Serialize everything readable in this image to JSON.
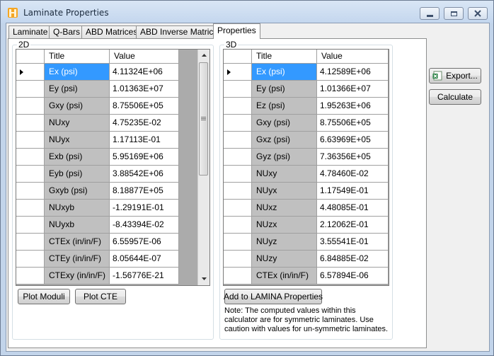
{
  "window": {
    "title": "Laminate Properties",
    "controls": [
      "minimize",
      "maximize",
      "close"
    ]
  },
  "tabs": [
    {
      "label": "Laminate",
      "active": false
    },
    {
      "label": "Q-Bars",
      "active": false
    },
    {
      "label": "ABD Matrices",
      "active": false
    },
    {
      "label": "ABD Inverse Matrices",
      "active": false
    },
    {
      "label": "Properties",
      "active": true
    }
  ],
  "group2d": {
    "title": "2D",
    "columns": {
      "title": "Title",
      "value": "Value"
    },
    "rows": [
      {
        "title": "Ex (psi)",
        "value": "4.11324E+06"
      },
      {
        "title": "Ey (psi)",
        "value": "1.01363E+07"
      },
      {
        "title": "Gxy (psi)",
        "value": "8.75506E+05"
      },
      {
        "title": "NUxy",
        "value": "4.75235E-02"
      },
      {
        "title": "NUyx",
        "value": "1.17113E-01"
      },
      {
        "title": "Exb (psi)",
        "value": "5.95169E+06"
      },
      {
        "title": "Eyb (psi)",
        "value": "3.88542E+06"
      },
      {
        "title": "Gxyb (psi)",
        "value": "8.18877E+05"
      },
      {
        "title": "NUxyb",
        "value": "-1.29191E-01"
      },
      {
        "title": "NUyxb",
        "value": "-8.43394E-02"
      },
      {
        "title": "CTEx (in/in/F)",
        "value": "6.55957E-06"
      },
      {
        "title": "CTEy (in/in/F)",
        "value": "8.05644E-07"
      },
      {
        "title": "CTExy (in/in/F)",
        "value": "-1.56776E-21"
      }
    ],
    "buttons": {
      "plot_moduli": "Plot Moduli",
      "plot_cte": "Plot CTE"
    }
  },
  "group3d": {
    "title": "3D",
    "columns": {
      "title": "Title",
      "value": "Value"
    },
    "rows": [
      {
        "title": "Ex (psi)",
        "value": "4.12589E+06"
      },
      {
        "title": "Ey (psi)",
        "value": "1.01366E+07"
      },
      {
        "title": "Ez (psi)",
        "value": "1.95263E+06"
      },
      {
        "title": "Gxy (psi)",
        "value": "8.75506E+05"
      },
      {
        "title": "Gxz (psi)",
        "value": "6.63969E+05"
      },
      {
        "title": "Gyz (psi)",
        "value": "7.36356E+05"
      },
      {
        "title": "NUxy",
        "value": "4.78460E-02"
      },
      {
        "title": "NUyx",
        "value": "1.17549E-01"
      },
      {
        "title": "NUxz",
        "value": "4.48085E-01"
      },
      {
        "title": "NUzx",
        "value": "2.12062E-01"
      },
      {
        "title": "NUyz",
        "value": "3.55541E-01"
      },
      {
        "title": "NUzy",
        "value": "6.84885E-02"
      },
      {
        "title": "CTEx (in/in/F)",
        "value": "6.57894E-06"
      }
    ],
    "button_add": "Add to LAMINA Properties",
    "note": "Note: The computed values within this calculator are for symmetric laminates. Use caution with values for un-symmetric laminates.",
    "note_lines": [
      "Note: The computed values within this",
      "calculator are for symmetric laminates. Use",
      "caution with values for un-symmetric laminates."
    ]
  },
  "side_buttons": {
    "export": "Export...",
    "calculate": "Calculate"
  },
  "selected_row": 0,
  "colors": {
    "selection": "#3399ff",
    "title_cell": "#c0c0c0",
    "grid_bg": "#ababab",
    "frame": "#c2d4ea"
  },
  "icons": [
    "laminate-app-icon",
    "minimize-icon",
    "maximize-icon",
    "close-icon",
    "row-indicator-icon",
    "excel-export-icon",
    "scroll-up-icon",
    "scroll-down-icon",
    "scroll-grip-icon"
  ]
}
